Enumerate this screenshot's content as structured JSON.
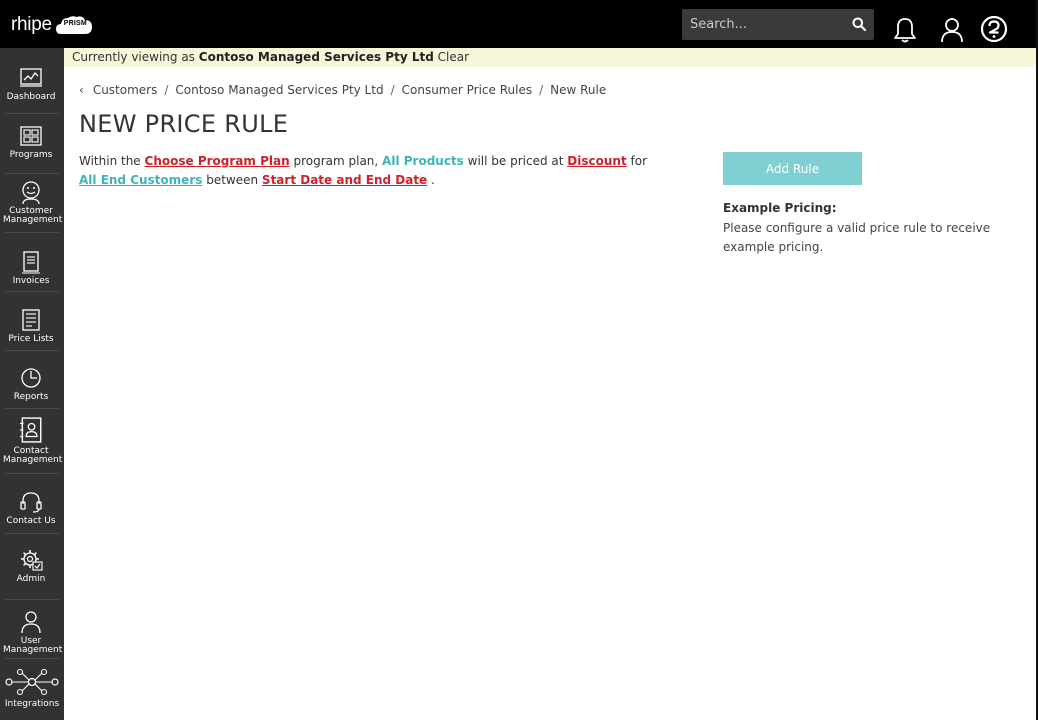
{
  "header": {
    "logo_text": "rhipe",
    "logo_badge": "PRISM",
    "search_placeholder": "Search..."
  },
  "sidebar": {
    "items": [
      {
        "label": "Dashboard",
        "icon": "dashboard-icon"
      },
      {
        "label": "Programs",
        "icon": "programs-icon"
      },
      {
        "label": "Customer Management",
        "icon": "customer-icon"
      },
      {
        "label": "Invoices",
        "icon": "invoice-icon"
      },
      {
        "label": "Price Lists",
        "icon": "price-list-icon"
      },
      {
        "label": "Reports",
        "icon": "reports-icon"
      },
      {
        "label": "Contact Management",
        "icon": "contact-book-icon"
      },
      {
        "label": "Contact Us",
        "icon": "headset-icon"
      },
      {
        "label": "Admin",
        "icon": "admin-gear-icon"
      },
      {
        "label": "User Management",
        "icon": "user-icon"
      },
      {
        "label": "Integrations",
        "icon": "integrations-icon"
      }
    ]
  },
  "banner": {
    "prefix": "Currently viewing as",
    "company": "Contoso Managed Services Pty Ltd",
    "clear": "Clear"
  },
  "breadcrumb": {
    "items": [
      "Customers",
      "Contoso Managed Services Pty Ltd",
      "Consumer Price Rules",
      "New Rule"
    ]
  },
  "page": {
    "title": "NEW PRICE RULE"
  },
  "rule": {
    "t1": "Within the",
    "program_plan": "Choose Program Plan",
    "t2": "program plan,",
    "products": "All Products",
    "t3": "will be priced at",
    "discount": "Discount",
    "t4": "for",
    "customers": "All End Customers",
    "t5": "between",
    "dates": "Start Date and End Date",
    "t6": "."
  },
  "actions": {
    "add_rule": "Add Rule"
  },
  "example": {
    "title": "Example Pricing:",
    "body": "Please configure a valid price rule to receive example pricing."
  },
  "colors": {
    "accent_teal": "#3fb4b8",
    "link_red": "#d0212b",
    "button_teal": "#7fcfd3",
    "sidebar_bg": "#323232",
    "banner_bg": "#f6f7d9"
  }
}
